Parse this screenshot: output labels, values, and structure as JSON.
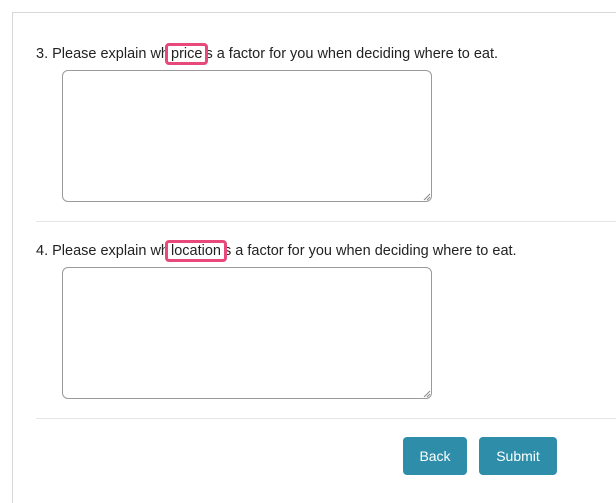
{
  "questions": [
    {
      "prefix": "3. Please explain wh",
      "highlight": "price",
      "suffix": "s a factor for you when deciding where to eat.",
      "answer": ""
    },
    {
      "prefix": "4. Please explain wh",
      "highlight": "location",
      "suffix": "s a factor for you when deciding where to eat.",
      "answer": ""
    }
  ],
  "buttons": {
    "back_label": "Back",
    "submit_label": "Submit"
  },
  "colors": {
    "highlight_border": "#e6497a",
    "button": "#2e8ea9"
  }
}
